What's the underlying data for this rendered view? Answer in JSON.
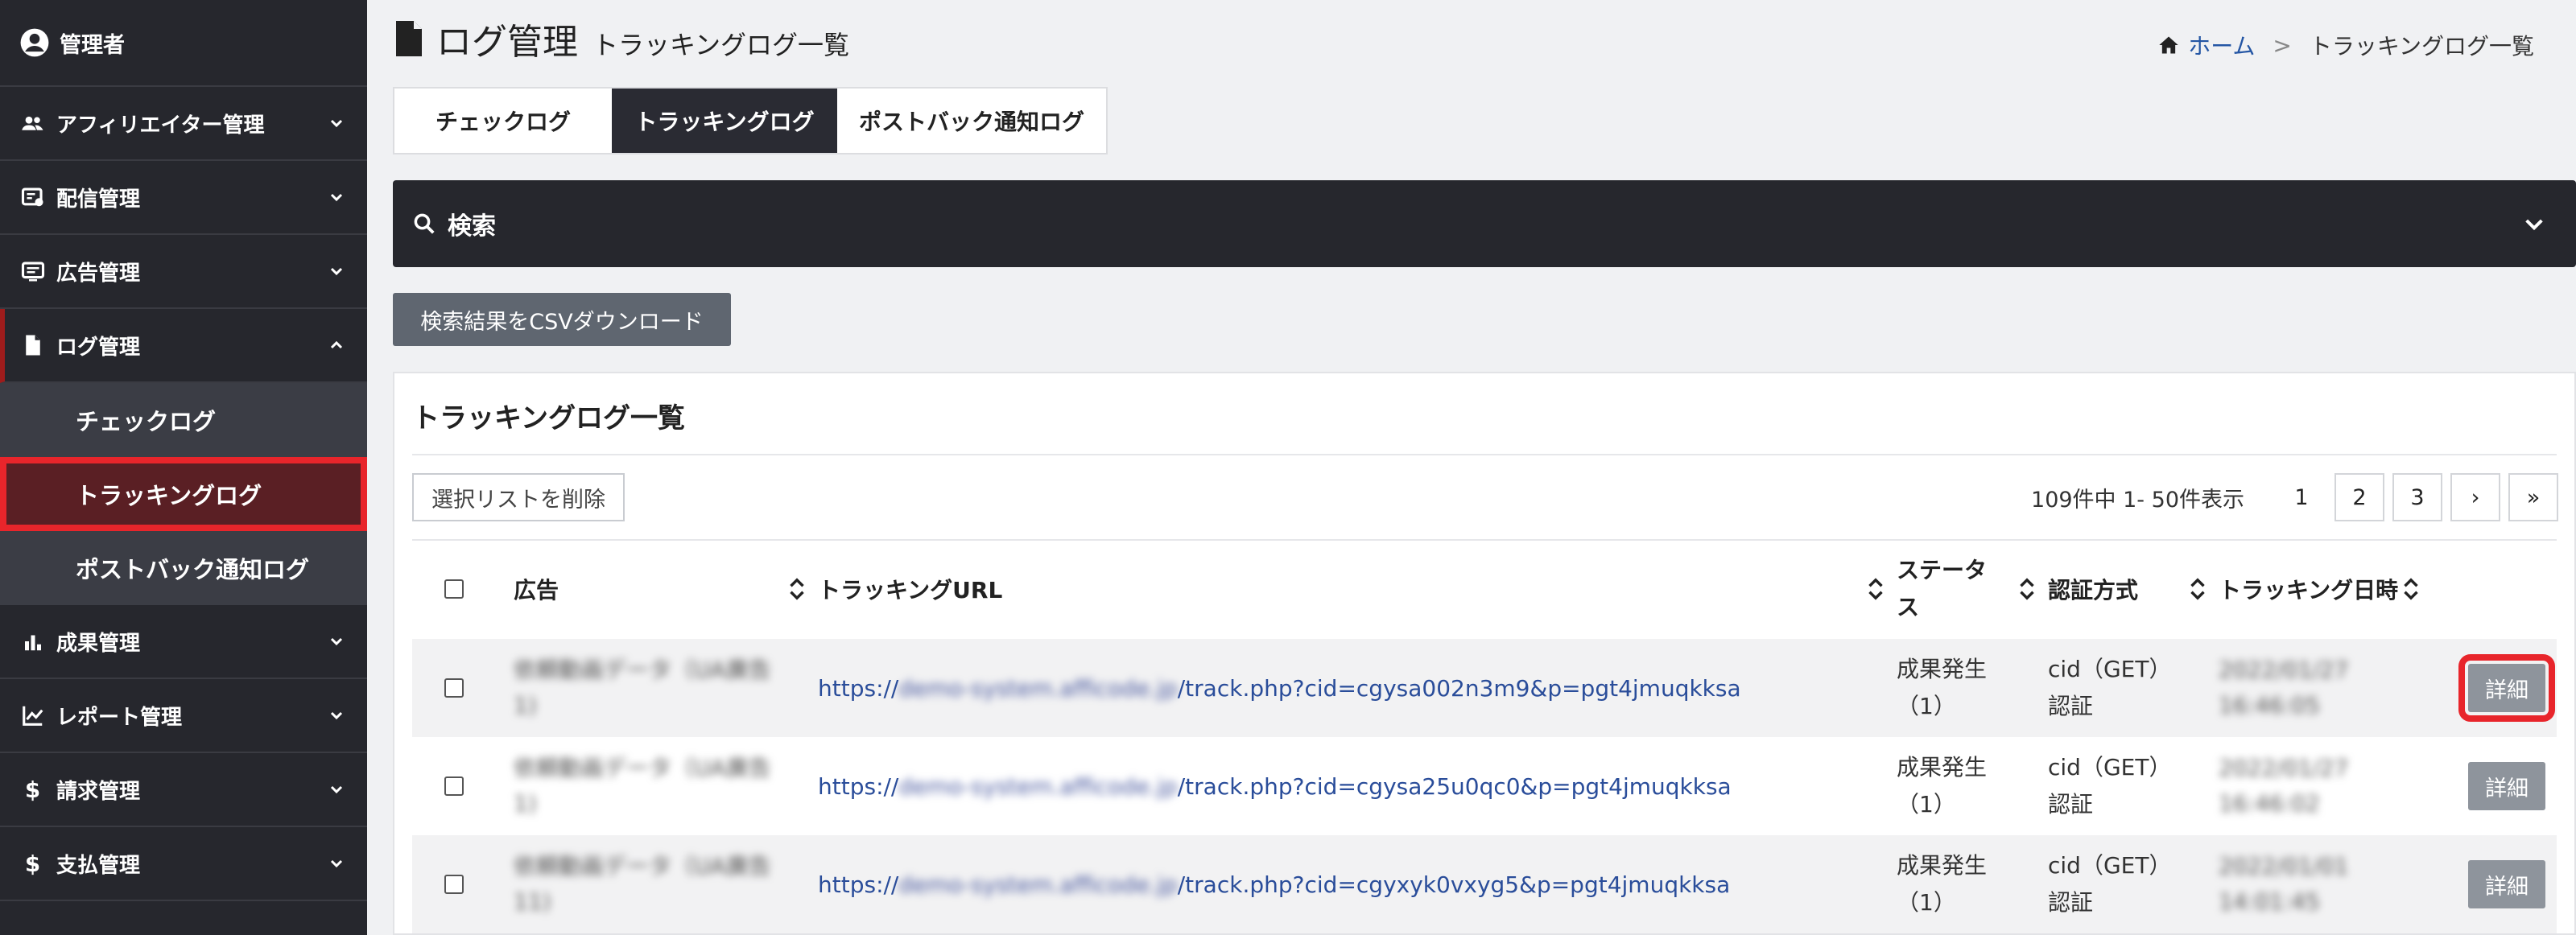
{
  "sidebar": {
    "user": "管理者",
    "items": [
      {
        "label": "アフィリエイター管理",
        "icon": "users-icon"
      },
      {
        "label": "配信管理",
        "icon": "delivery-icon"
      },
      {
        "label": "広告管理",
        "icon": "ad-icon"
      },
      {
        "label": "ログ管理",
        "icon": "file-icon"
      },
      {
        "label": "成果管理",
        "icon": "bar-chart-icon"
      },
      {
        "label": "レポート管理",
        "icon": "line-chart-icon"
      },
      {
        "label": "請求管理",
        "icon": "dollar-icon"
      },
      {
        "label": "支払管理",
        "icon": "dollar-icon"
      }
    ],
    "log_sub": [
      "チェックログ",
      "トラッキングログ",
      "ポストバック通知ログ"
    ]
  },
  "header": {
    "title": "ログ管理",
    "subtitle": "トラッキングログ一覧",
    "breadcrumb_home": "ホーム",
    "breadcrumb_sep": ">",
    "breadcrumb_current": "トラッキングログ一覧"
  },
  "tabs": [
    "チェックログ",
    "トラッキングログ",
    "ポストバック通知ログ"
  ],
  "search": {
    "label": "検索"
  },
  "csv_button": "検索結果をCSVダウンロード",
  "list": {
    "title": "トラッキングログ一覧",
    "delete_button": "選択リストを削除",
    "pagination_info": "109件中 1- 50件表示",
    "pages": [
      "1",
      "2",
      "3",
      "›",
      "»"
    ],
    "columns": [
      "広告",
      "トラッキングURL",
      "ステータス",
      "認証方式",
      "トラッキング日時"
    ],
    "status_header_line1": "ステータ",
    "status_header_line2": "ス",
    "rows": [
      {
        "ad_l1": "依頼動画データ（UA廣告",
        "ad_l2": "1)",
        "url_prefix": "https://",
        "url_host": "demo-system.afficode.jp",
        "url_path": "/track.php?cid=cgysa002n3m9&p=pgt4jmuqkksa",
        "status_l1": "成果発生",
        "status_l2": "（1）",
        "auth_l1": "cid（GET）",
        "auth_l2": "認証",
        "date_l1": "2022/01/27",
        "date_l2": "16:46:05",
        "action": "詳細"
      },
      {
        "ad_l1": "依頼動画データ（UA廣告",
        "ad_l2": "1)",
        "url_prefix": "https://",
        "url_host": "demo-system.afficode.jp",
        "url_path": "/track.php?cid=cgysa25u0qc0&p=pgt4jmuqkksa",
        "status_l1": "成果発生",
        "status_l2": "（1）",
        "auth_l1": "cid（GET）",
        "auth_l2": "認証",
        "date_l1": "2022/01/27",
        "date_l2": "16:46:02",
        "action": "詳細"
      },
      {
        "ad_l1": "依頼動画データ（UA廣告",
        "ad_l2": "11)",
        "url_prefix": "https://",
        "url_host": "demo-system.afficode.jp",
        "url_path": "/track.php?cid=cgyxyk0vxyg5&p=pgt4jmuqkksa",
        "status_l1": "成果発生",
        "status_l2": "（1）",
        "auth_l1": "cid（GET）",
        "auth_l2": "認証",
        "date_l1": "2022/01/01",
        "date_l2": "14:01:45",
        "action": "詳細"
      }
    ]
  },
  "colors": {
    "sidebar_bg": "#26272d",
    "highlight": "#e8252b",
    "link": "#2a4d9a",
    "active_tab_bg": "#2a2b33"
  }
}
